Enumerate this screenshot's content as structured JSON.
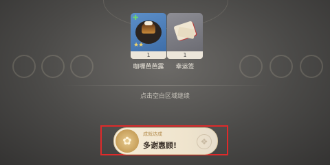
{
  "rewards": [
    {
      "name": "咖喱芭芭露",
      "count": "1",
      "icon": "coffee-flan-dish-icon",
      "rarity_stars": "★★"
    },
    {
      "name": "幸运签",
      "count": "1",
      "icon": "fortune-slip-icon"
    }
  ],
  "continue_hint": "点击空白区域继续",
  "achievement": {
    "label": "成就达成",
    "title": "多谢惠顾!"
  },
  "colors": {
    "highlight_frame": "#e02a2a",
    "rare_card": "#3f6ea8",
    "common_card": "#6c6c73"
  }
}
